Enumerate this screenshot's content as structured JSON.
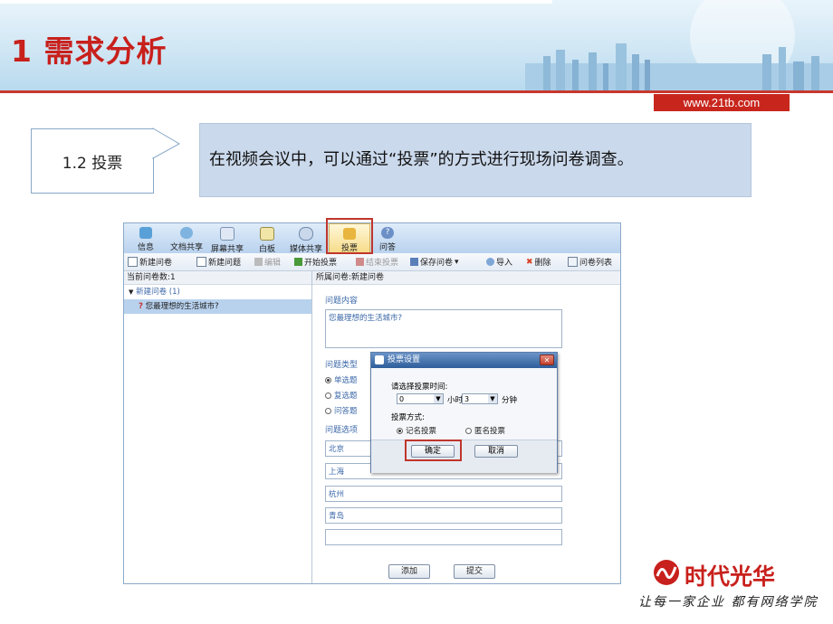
{
  "slide": {
    "title": "1 需求分析",
    "url": "www.21tb.com",
    "section_label": "1.2 投票",
    "callout_text": "在视频会议中，可以通过“投票”的方式进行现场问卷调查。",
    "brand": {
      "name": "时代光华",
      "slogan": "让每一家企业 都有网络学院",
      "color": "#c8201c"
    }
  },
  "app": {
    "tabs": [
      {
        "label": "信息",
        "icon": "info-icon"
      },
      {
        "label": "文档共享",
        "icon": "cloud-icon"
      },
      {
        "label": "屏幕共享",
        "icon": "screen-icon"
      },
      {
        "label": "白板",
        "icon": "whiteboard-icon"
      },
      {
        "label": "媒体共享",
        "icon": "media-icon"
      },
      {
        "label": "投票",
        "icon": "vote-icon",
        "active": true
      },
      {
        "label": "问答",
        "icon": "help-icon"
      }
    ],
    "toolbar": {
      "new_survey": "新建问卷",
      "new_question": "新建问题",
      "edit": "编辑",
      "start_vote": "开始投票",
      "end_vote": "结束投票",
      "save_survey": "保存问卷",
      "import": "导入",
      "delete": "删除",
      "survey_list": "问卷列表"
    },
    "left_panel": {
      "header": "当前问卷数:1",
      "survey_name": "新建问卷 (1)",
      "question": "您最理想的生活城市?"
    },
    "right_panel": {
      "header": "所属问卷:新建问卷",
      "content_label": "问题内容",
      "content_value": "您最理想的生活城市?",
      "type_label": "问题类型",
      "types": [
        "单选题",
        "复选题",
        "问答题"
      ],
      "options_label": "问题选项",
      "options": [
        "北京",
        "上海",
        "杭州",
        "青岛",
        ""
      ],
      "add_button": "添加",
      "submit_button": "提交"
    },
    "dialog": {
      "title": "投票设置",
      "close": "✕",
      "time_label": "请选择投票时间:",
      "hours_value": "0",
      "hours_unit": "小时",
      "minutes_value": "3",
      "minutes_unit": "分钟",
      "mode_label": "投票方式:",
      "mode_named": "记名投票",
      "mode_anonymous": "匿名投票",
      "ok": "确定",
      "cancel": "取消"
    }
  }
}
